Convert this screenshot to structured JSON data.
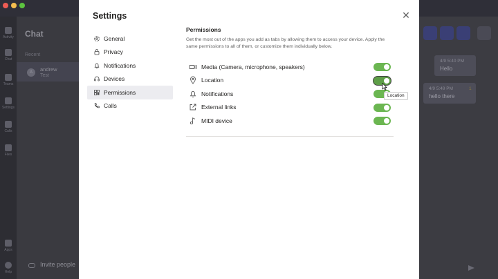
{
  "background": {
    "chat_header": "Chat",
    "recent_label": "Recent",
    "chat_item": {
      "avatar": "A",
      "name": "andrew",
      "preview": "Test"
    },
    "rail_labels": [
      "Activity",
      "Chat",
      "Teams",
      "Settings",
      "Calls",
      "Files",
      "Apps",
      "Help"
    ],
    "invite_label": "Invite people",
    "messages": [
      {
        "time": "4/9 5:40 PM",
        "text": "Hello"
      },
      {
        "time": "4/9 5:49 PM",
        "text": "hello there"
      }
    ],
    "reaction": "1"
  },
  "dialog": {
    "title": "Settings",
    "close_glyph": "✕",
    "nav": [
      {
        "label": "General",
        "icon": "gear-icon"
      },
      {
        "label": "Privacy",
        "icon": "lock-icon"
      },
      {
        "label": "Notifications",
        "icon": "bell-icon"
      },
      {
        "label": "Devices",
        "icon": "headset-icon"
      },
      {
        "label": "Permissions",
        "icon": "grid-icon"
      },
      {
        "label": "Calls",
        "icon": "phone-icon"
      }
    ],
    "active_nav": "Permissions",
    "permissions": {
      "title": "Permissions",
      "description": "Get the most out of the apps you add as tabs by allowing them to access your device. Apply the same permissions to all of them, or customize them individually below.",
      "items": [
        {
          "label": "Media (Camera, microphone, speakers)",
          "icon": "camera-icon",
          "enabled": true
        },
        {
          "label": "Location",
          "icon": "location-pin-icon",
          "enabled": true
        },
        {
          "label": "Notifications",
          "icon": "bell-icon",
          "enabled": true
        },
        {
          "label": "External links",
          "icon": "external-link-icon",
          "enabled": true
        },
        {
          "label": "MIDI device",
          "icon": "music-note-icon",
          "enabled": true
        }
      ]
    },
    "tooltip": "Location"
  },
  "colors": {
    "toggle_on": "#6bb651",
    "accent": "#464775",
    "dialog_bg": "#ffffff"
  }
}
